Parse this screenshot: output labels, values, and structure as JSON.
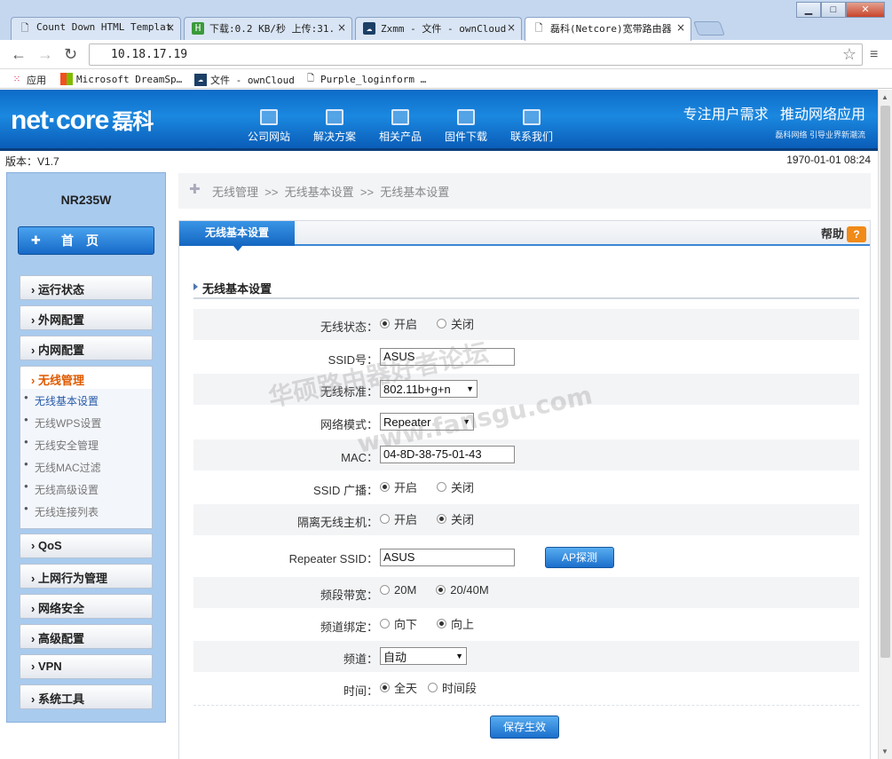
{
  "browser": {
    "tabs": [
      {
        "title": "Count Down HTML Templat",
        "icon": "page-icon"
      },
      {
        "title": "下载:0.2 KB/秒 上传:31.",
        "icon": "download-app-icon"
      },
      {
        "title": "Zxmm - 文件 - ownCloud",
        "icon": "cloud-icon"
      },
      {
        "title": "磊科(Netcore)宽带路由器",
        "icon": "page-icon"
      }
    ],
    "url": "10.18.17.19",
    "bookmarks": [
      {
        "label": "应用",
        "icon": "apps-grid-icon"
      },
      {
        "label": "Microsoft DreamSp…",
        "icon": "windows-logo-icon"
      },
      {
        "label": "文件 - ownCloud",
        "icon": "cloud-icon"
      },
      {
        "label": "Purple_loginform …",
        "icon": "page-icon"
      }
    ]
  },
  "header": {
    "logo": "net·core",
    "logo_cn": "磊科",
    "nav": [
      "公司网站",
      "解决方案",
      "相关产品",
      "固件下载",
      "联系我们"
    ],
    "slogan": "专注用户需求   推动网络应用",
    "slogan_sub": "磊科网络 引导业界新潮流"
  },
  "status": {
    "version": "版本：V1.7",
    "datetime": "1970-01-01 08:24"
  },
  "sidebar": {
    "model": "NR235W",
    "home": "首页",
    "menu_top": [
      "运行状态",
      "外网配置",
      "内网配置",
      "无线管理"
    ],
    "submenu": [
      "无线基本设置",
      "无线WPS设置",
      "无线安全管理",
      "无线MAC过滤",
      "无线高级设置",
      "无线连接列表"
    ],
    "menu_bottom": [
      "QoS",
      "上网行为管理",
      "网络安全",
      "高级配置",
      "VPN",
      "系统工具"
    ]
  },
  "breadcrumb": "无线管理  >>  无线基本设置  >>  无线基本设置",
  "panel": {
    "tab": "无线基本设置",
    "help": "帮助",
    "section_title": "无线基本设置",
    "fields": {
      "wireless_status": {
        "label": "无线状态：",
        "opt1": "开启",
        "opt2": "关闭"
      },
      "ssid": {
        "label": "SSID号：",
        "value": "ASUS"
      },
      "standard": {
        "label": "无线标准：",
        "value": "802.11b+g+n"
      },
      "mode": {
        "label": "网络模式：",
        "value": "Repeater"
      },
      "mac": {
        "label": "MAC：",
        "value": "04-8D-38-75-01-43"
      },
      "ssid_broadcast": {
        "label": "SSID 广播：",
        "opt1": "开启",
        "opt2": "关闭"
      },
      "isolate": {
        "label": "隔离无线主机：",
        "opt1": "开启",
        "opt2": "关闭"
      },
      "repeater_ssid": {
        "label": "Repeater SSID：",
        "value": "ASUS",
        "button": "AP探测"
      },
      "bandwidth": {
        "label": "频段带宽：",
        "opt1": "20M",
        "opt2": "20/40M"
      },
      "channel_bind": {
        "label": "频道绑定：",
        "opt1": "向下",
        "opt2": "向上"
      },
      "channel": {
        "label": "频道：",
        "value": "自动"
      },
      "time": {
        "label": "时间：",
        "opt1": "全天",
        "opt2": "时间段"
      }
    },
    "save_button": "保存生效"
  },
  "watermark": {
    "line1": "华硕路由器好者论坛",
    "line2": "www.fansgu.com"
  }
}
